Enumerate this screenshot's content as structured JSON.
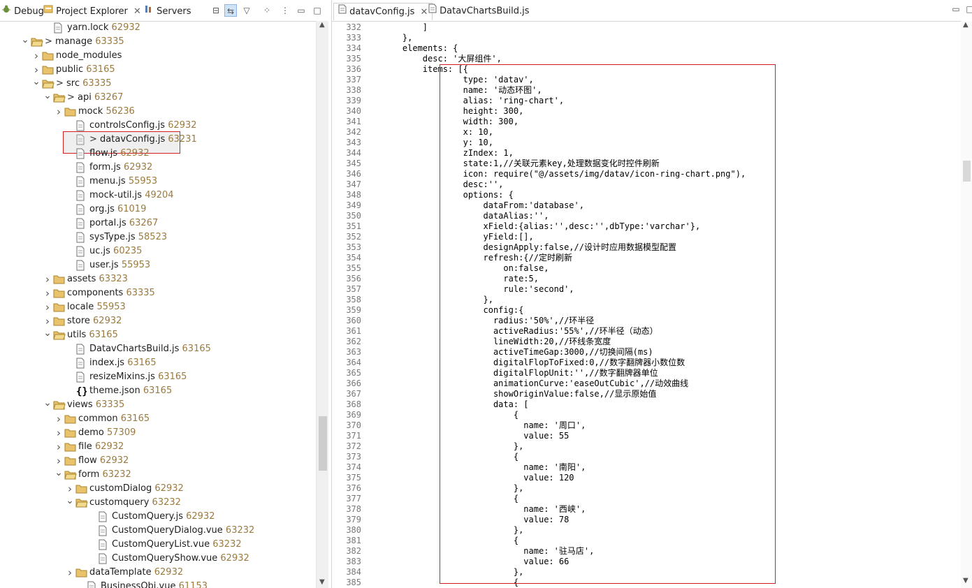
{
  "left_tabs": [
    {
      "label": "Debug"
    },
    {
      "label": "Project Explorer"
    },
    {
      "label": "Servers"
    }
  ],
  "tree": [
    {
      "level": 4,
      "type": "file",
      "name": "yarn.lock",
      "num": "62932",
      "twisty": ""
    },
    {
      "level": 2,
      "type": "folder",
      "name": "manage",
      "num": "63335",
      "twisty": "open",
      "prefix": "> "
    },
    {
      "level": 3,
      "type": "folder",
      "name": "node_modules",
      "num": "",
      "twisty": "closed"
    },
    {
      "level": 3,
      "type": "folder",
      "name": "public",
      "num": "63165",
      "twisty": "closed"
    },
    {
      "level": 3,
      "type": "folder",
      "name": "src",
      "num": "63335",
      "twisty": "open",
      "prefix": "> "
    },
    {
      "level": 4,
      "type": "folder",
      "name": "api",
      "num": "63267",
      "twisty": "open",
      "prefix": "> "
    },
    {
      "level": 5,
      "type": "folder",
      "name": "mock",
      "num": "56236",
      "twisty": "closed"
    },
    {
      "level": 6,
      "type": "file",
      "name": "controlsConfig.js",
      "num": "62932",
      "twisty": ""
    },
    {
      "level": 6,
      "type": "file",
      "name": "datavConfig.js",
      "num": "63231",
      "twisty": "",
      "prefix": "> ",
      "highlight": true
    },
    {
      "level": 6,
      "type": "file",
      "name": "flow.js",
      "num": "62932",
      "twisty": ""
    },
    {
      "level": 6,
      "type": "file",
      "name": "form.js",
      "num": "62932",
      "twisty": ""
    },
    {
      "level": 6,
      "type": "file",
      "name": "menu.js",
      "num": "55953",
      "twisty": ""
    },
    {
      "level": 6,
      "type": "file",
      "name": "mock-util.js",
      "num": "49204",
      "twisty": ""
    },
    {
      "level": 6,
      "type": "file",
      "name": "org.js",
      "num": "61019",
      "twisty": ""
    },
    {
      "level": 6,
      "type": "file",
      "name": "portal.js",
      "num": "63267",
      "twisty": ""
    },
    {
      "level": 6,
      "type": "file",
      "name": "sysType.js",
      "num": "58523",
      "twisty": ""
    },
    {
      "level": 6,
      "type": "file",
      "name": "uc.js",
      "num": "60235",
      "twisty": ""
    },
    {
      "level": 6,
      "type": "file",
      "name": "user.js",
      "num": "55953",
      "twisty": ""
    },
    {
      "level": 4,
      "type": "folder",
      "name": "assets",
      "num": "63323",
      "twisty": "closed"
    },
    {
      "level": 4,
      "type": "folder",
      "name": "components",
      "num": "63335",
      "twisty": "closed"
    },
    {
      "level": 4,
      "type": "folder",
      "name": "locale",
      "num": "55953",
      "twisty": "closed"
    },
    {
      "level": 4,
      "type": "folder",
      "name": "store",
      "num": "62932",
      "twisty": "closed"
    },
    {
      "level": 4,
      "type": "folder",
      "name": "utils",
      "num": "63165",
      "twisty": "open"
    },
    {
      "level": 6,
      "type": "file",
      "name": "DatavChartsBuild.js",
      "num": "63165",
      "twisty": ""
    },
    {
      "level": 6,
      "type": "file",
      "name": "index.js",
      "num": "63165",
      "twisty": ""
    },
    {
      "level": 6,
      "type": "file",
      "name": "resizeMixins.js",
      "num": "63165",
      "twisty": ""
    },
    {
      "level": 6,
      "type": "json",
      "name": "theme.json",
      "num": "63165",
      "twisty": ""
    },
    {
      "level": 4,
      "type": "folder",
      "name": "views",
      "num": "63335",
      "twisty": "open"
    },
    {
      "level": 5,
      "type": "folder",
      "name": "common",
      "num": "63165",
      "twisty": "closed"
    },
    {
      "level": 5,
      "type": "folder",
      "name": "demo",
      "num": "57309",
      "twisty": "closed"
    },
    {
      "level": 5,
      "type": "folder",
      "name": "file",
      "num": "62932",
      "twisty": "closed"
    },
    {
      "level": 5,
      "type": "folder",
      "name": "flow",
      "num": "62932",
      "twisty": "closed"
    },
    {
      "level": 5,
      "type": "folder",
      "name": "form",
      "num": "63232",
      "twisty": "open"
    },
    {
      "level": 6,
      "type": "folder",
      "name": "customDialog",
      "num": "62932",
      "twisty": "closed"
    },
    {
      "level": 6,
      "type": "folder",
      "name": "customquery",
      "num": "63232",
      "twisty": "open"
    },
    {
      "level": 8,
      "type": "file",
      "name": "CustomQuery.js",
      "num": "62932",
      "twisty": ""
    },
    {
      "level": 8,
      "type": "file",
      "name": "CustomQueryDialog.vue",
      "num": "63232",
      "twisty": ""
    },
    {
      "level": 8,
      "type": "file",
      "name": "CustomQueryList.vue",
      "num": "63232",
      "twisty": ""
    },
    {
      "level": 8,
      "type": "file",
      "name": "CustomQueryShow.vue",
      "num": "62932",
      "twisty": ""
    },
    {
      "level": 6,
      "type": "folder",
      "name": "dataTemplate",
      "num": "62932",
      "twisty": "closed"
    },
    {
      "level": 7,
      "type": "file",
      "name": "BusinessObj.vue",
      "num": "61153",
      "twisty": ""
    }
  ],
  "editor_tabs": [
    {
      "label": "datavConfig.js",
      "active": true
    },
    {
      "label": "DatavChartsBuild.js",
      "active": false
    }
  ],
  "code": [
    {
      "n": "332",
      "t": "        ]"
    },
    {
      "n": "333",
      "t": "    },"
    },
    {
      "n": "334",
      "t": "    elements: {"
    },
    {
      "n": "335",
      "t": "        desc: '大屏组件',"
    },
    {
      "n": "336",
      "t": "        items: [{"
    },
    {
      "n": "337",
      "t": "                type: 'datav',"
    },
    {
      "n": "338",
      "t": "                name: '动态环图',"
    },
    {
      "n": "339",
      "t": "                alias: 'ring-chart',"
    },
    {
      "n": "340",
      "t": "                height: 300,"
    },
    {
      "n": "341",
      "t": "                width: 300,"
    },
    {
      "n": "342",
      "t": "                x: 10,"
    },
    {
      "n": "343",
      "t": "                y: 10,"
    },
    {
      "n": "344",
      "t": "                zIndex: 1,"
    },
    {
      "n": "345",
      "t": "                state:1,//关联元素key,处理数据变化时控件刷新"
    },
    {
      "n": "346",
      "t": "                icon: require(\"@/assets/img/datav/icon-ring-chart.png\"),"
    },
    {
      "n": "347",
      "t": "                desc:'',"
    },
    {
      "n": "348",
      "t": "                options: {"
    },
    {
      "n": "349",
      "t": "                    dataFrom:'database',"
    },
    {
      "n": "350",
      "t": "                    dataAlias:'',"
    },
    {
      "n": "351",
      "t": "                    xField:{alias:'',desc:'',dbType:'varchar'},"
    },
    {
      "n": "352",
      "t": "                    yField:[],"
    },
    {
      "n": "353",
      "t": "                    designApply:false,//设计时应用数据模型配置"
    },
    {
      "n": "354",
      "t": "                    refresh:{//定时刷新"
    },
    {
      "n": "355",
      "t": "                        on:false,"
    },
    {
      "n": "356",
      "t": "                        rate:5,"
    },
    {
      "n": "357",
      "t": "                        rule:'second',"
    },
    {
      "n": "358",
      "t": "                    },"
    },
    {
      "n": "359",
      "t": "                    config:{"
    },
    {
      "n": "360",
      "t": "                      radius:'50%',//环半径"
    },
    {
      "n": "361",
      "t": "                      activeRadius:'55%',//环半径（动态）"
    },
    {
      "n": "362",
      "t": "                      lineWidth:20,//环线条宽度"
    },
    {
      "n": "363",
      "t": "                      activeTimeGap:3000,//切换间隔(ms)"
    },
    {
      "n": "364",
      "t": "                      digitalFlopToFixed:0,//数字翻牌器小数位数"
    },
    {
      "n": "365",
      "t": "                      digitalFlopUnit:'',//数字翻牌器单位"
    },
    {
      "n": "366",
      "t": "                      animationCurve:'easeOutCubic',//动效曲线"
    },
    {
      "n": "367",
      "t": "                      showOriginValue:false,//显示原始值"
    },
    {
      "n": "368",
      "t": "                      data: ["
    },
    {
      "n": "369",
      "t": "                          {"
    },
    {
      "n": "370",
      "t": "                            name: '周口',"
    },
    {
      "n": "371",
      "t": "                            value: 55"
    },
    {
      "n": "372",
      "t": "                          },"
    },
    {
      "n": "373",
      "t": "                          {"
    },
    {
      "n": "374",
      "t": "                            name: '南阳',"
    },
    {
      "n": "375",
      "t": "                            value: 120"
    },
    {
      "n": "376",
      "t": "                          },"
    },
    {
      "n": "377",
      "t": "                          {"
    },
    {
      "n": "378",
      "t": "                            name: '西峡',"
    },
    {
      "n": "379",
      "t": "                            value: 78"
    },
    {
      "n": "380",
      "t": "                          },"
    },
    {
      "n": "381",
      "t": "                          {"
    },
    {
      "n": "382",
      "t": "                            name: '驻马店',"
    },
    {
      "n": "383",
      "t": "                            value: 66"
    },
    {
      "n": "384",
      "t": "                          },"
    },
    {
      "n": "385",
      "t": "                          {"
    }
  ],
  "colors": {
    "highlight_frame": "#d21e1e",
    "number": "#9b7a3f",
    "line_number": "#787878"
  }
}
